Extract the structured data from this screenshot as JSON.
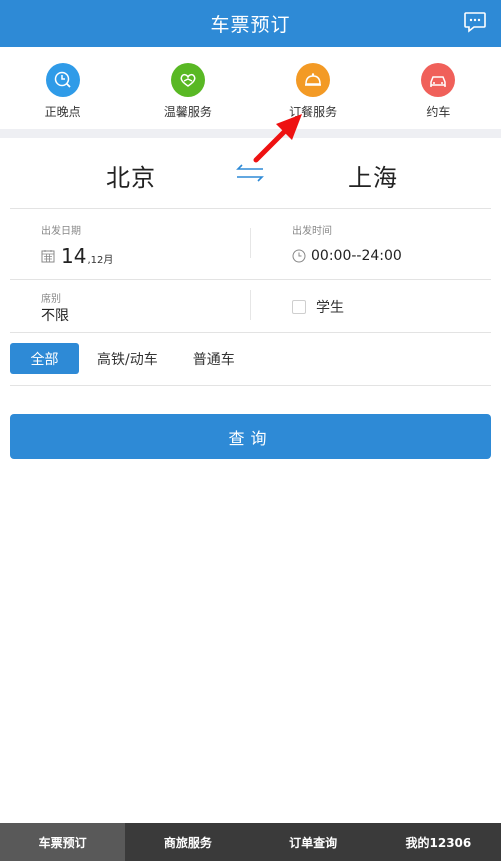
{
  "header": {
    "title": "车票预订",
    "message_icon": "chat-bubble-icon"
  },
  "quick_services": [
    {
      "label": "正晚点",
      "icon": "clock-search-icon",
      "color": "#2f9be8"
    },
    {
      "label": "温馨服务",
      "icon": "heart-hands-icon",
      "color": "#59b824"
    },
    {
      "label": "订餐服务",
      "icon": "food-cloche-icon",
      "color": "#f39a25"
    },
    {
      "label": "约车",
      "icon": "car-icon",
      "color": "#f0605a"
    }
  ],
  "route": {
    "from": "北京",
    "to": "上海",
    "swap_icon": "swap-arrows-icon"
  },
  "departure_date": {
    "label": "出发日期",
    "day": "14",
    "month": ",12月"
  },
  "departure_time": {
    "label": "出发时间",
    "value": "00:00--24:00"
  },
  "seat": {
    "label": "席别",
    "value": "不限"
  },
  "student": {
    "label": "学生",
    "checked": false
  },
  "train_types": [
    {
      "label": "全部",
      "active": true
    },
    {
      "label": "高铁/动车",
      "active": false
    },
    {
      "label": "普通车",
      "active": false
    }
  ],
  "query_button": {
    "label": "查询"
  },
  "bottom_tabs": [
    {
      "label": "车票预订",
      "active": true
    },
    {
      "label": "商旅服务",
      "active": false
    },
    {
      "label": "订单查询",
      "active": false
    },
    {
      "label": "我的12306",
      "active": false
    }
  ],
  "colors": {
    "primary": "#2e8ad6",
    "annotation_arrow": "#ee1111"
  }
}
